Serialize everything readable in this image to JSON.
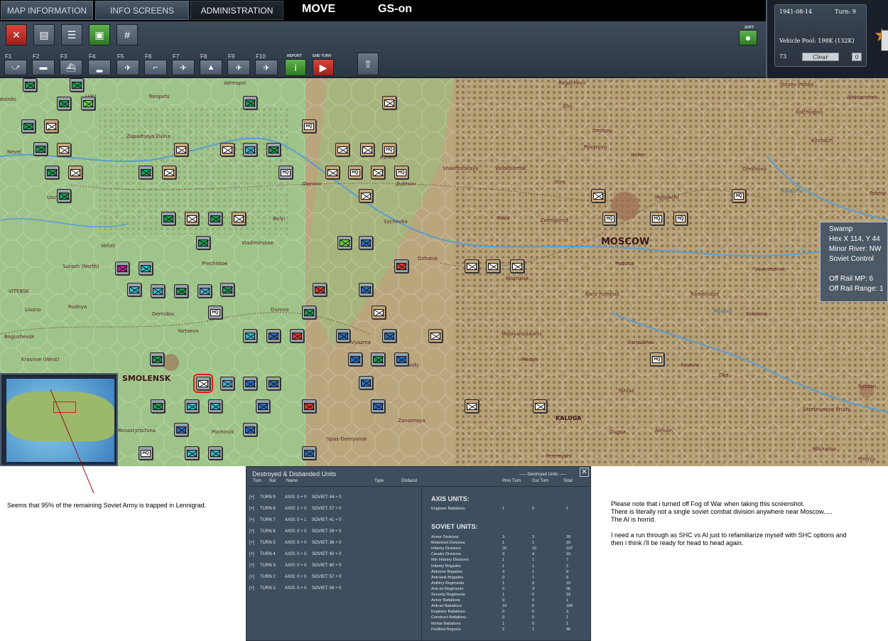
{
  "tabs": [
    "MAP INFORMATION",
    "INFO SCREENS",
    "ADMINISTRATION"
  ],
  "mode": "MOVE",
  "gs": "GS-on",
  "fkeys": [
    "F1",
    "F2",
    "F3",
    "F4",
    "F5",
    "F6",
    "F7",
    "F8",
    "F9",
    "F10"
  ],
  "report_label": "REPORT",
  "endturn_label": "END TURN",
  "soft_label": "SOFT",
  "info": {
    "date": "1941-08-14",
    "turn": "Turn: 9",
    "vehicle_pool": "Vehicle Pool: 198K (132K)",
    "num": "73",
    "clear": "Clear",
    "zero": "0"
  },
  "tooltip": {
    "terrain": "Swamp",
    "hex": "Hex X 114, Y 44",
    "river": "Minor River: NW",
    "control": "Soviet Control",
    "mp": "Off Rail MP: 6",
    "range": "Off Rail Range: 1"
  },
  "map_labels": [
    "LUKI",
    "Toropets",
    "Adreapol",
    "Rogachevo",
    "Klin",
    "Kolniki",
    "Yuryev-Polsky",
    "Kolchugino",
    "Aleksandrov",
    "Kirzhach",
    "Dmitrov",
    "Pokrov",
    "Nevel",
    "Zapadnaya Dvina",
    "Shakhovskaya",
    "Volokolamsk",
    "Istra",
    "Ikshe",
    "Povarovo",
    "Orekhovo",
    "Usvyat",
    "Olenino",
    "Zubtsov",
    "Rzhev",
    "Mytishchi",
    "Sychevka",
    "Ruza",
    "Zvenigorod",
    "Belyi",
    "Velizh",
    "Vladimirskoe",
    "Ozhatsk",
    "Mozhaisk",
    "Podolsk",
    "Voskresensk",
    "Surazh (North)",
    "Prechistoe",
    "VITEBSK",
    "Rudnya",
    "Liozno",
    "Demidov",
    "Durovo",
    "Naro-Fominsk",
    "Ramenskoe",
    "Kolomna",
    "Yartsevo",
    "Bogushevsk",
    "Krasnoe (West)",
    "Vyazma",
    "Maloyaroslavets",
    "Medyn",
    "Serpukhov",
    "Kashira",
    "Vskhody",
    "Zanoznaya",
    "Tarusa",
    "Oka",
    "Ryazan",
    "Serebryanye Prudy",
    "Pochinok",
    "Monastyrschina",
    "Spas-Demyansk",
    "Aleksin",
    "Dugna",
    "Mikhailov",
    "Peremyshl",
    "Pronya",
    "Moskva",
    "Klyazma"
  ],
  "city_labels": {
    "moscow": "MOSCOW",
    "smolensk": "SMOLENSK",
    "kaluga": "KALUGA"
  },
  "dialog": {
    "title": "Destroyed & Disbanded Units",
    "col_turn": "Turn",
    "col_nat": "Nat",
    "col_name": "Name",
    "col_type": "Type",
    "col_disband": "Disband",
    "col_destroyed": "----- Destroyed Units -----",
    "col_prev": "Prev Turn",
    "col_cur": "Cur Turn",
    "col_total": "Total",
    "turns": [
      {
        "t": "TURN 9",
        "axis": "AXIS: 0 + 0",
        "soviet": "SOVIET: 44 + 0"
      },
      {
        "t": "TURN 8",
        "axis": "AXIS: 1 + 0",
        "soviet": "SOVIET: 57 + 0"
      },
      {
        "t": "TURN 7",
        "axis": "AXIS: 0 + 1",
        "soviet": "SOVIET: 41 + 0"
      },
      {
        "t": "TURN 6",
        "axis": "AXIS: 0 + 0",
        "soviet": "SOVIET: 29 + 0"
      },
      {
        "t": "TURN 5",
        "axis": "AXIS: 0 + 0",
        "soviet": "SOVIET: 36 + 0"
      },
      {
        "t": "TURN 4",
        "axis": "AXIS: 0 + 0",
        "soviet": "SOVIET: 40 + 0"
      },
      {
        "t": "TURN 3",
        "axis": "AXIS: 0 + 0",
        "soviet": "SOVIET: 60 + 0"
      },
      {
        "t": "TURN 2",
        "axis": "AXIS: 0 + 0",
        "soviet": "SOVIET: 57 + 0"
      },
      {
        "t": "TURN 1",
        "axis": "AXIS: 0 + 0",
        "soviet": "SOVIET: 58 + 0"
      }
    ],
    "axis_header": "AXIS UNITS:",
    "axis_rows": [
      {
        "name": "Engineer Battalions",
        "prev": "1",
        "cur": "0",
        "total": "1"
      }
    ],
    "soviet_header": "SOVIET UNITS:",
    "soviet_rows": [
      {
        "name": "Armor Divisions",
        "prev": "3",
        "cur": "3",
        "total": "39"
      },
      {
        "name": "Motorized Divisions",
        "prev": "1",
        "cur": "1",
        "total": "20"
      },
      {
        "name": "Infantry Divisions",
        "prev": "26",
        "cur": "22",
        "total": "107"
      },
      {
        "name": "Cavalry Divisions",
        "prev": "3",
        "cur": "4",
        "total": "15"
      },
      {
        "name": "Mtn Infantry Divisions",
        "prev": "1",
        "cur": "1",
        "total": "7"
      },
      {
        "name": "Infantry Brigades",
        "prev": "1",
        "cur": "1",
        "total": "2"
      },
      {
        "name": "Airborne Brigades",
        "prev": "3",
        "cur": "1",
        "total": "9"
      },
      {
        "name": "Anti-tank Brigades",
        "prev": "0",
        "cur": "1",
        "total": "9"
      },
      {
        "name": "Artillery Regiments",
        "prev": "1",
        "cur": "0",
        "total": "10"
      },
      {
        "name": "Anti-air Regiments",
        "prev": "5",
        "cur": "3",
        "total": "26"
      },
      {
        "name": "Security Regiments",
        "prev": "1",
        "cur": "0",
        "total": "18"
      },
      {
        "name": "Armor Battalions",
        "prev": "0",
        "cur": "0",
        "total": "1"
      },
      {
        "name": "Anti-air Battalions",
        "prev": "10",
        "cur": "6",
        "total": "106"
      },
      {
        "name": "Engineer Battalions",
        "prev": "0",
        "cur": "0",
        "total": "3"
      },
      {
        "name": "Construct Battalions",
        "prev": "0",
        "cur": "0",
        "total": "1"
      },
      {
        "name": "Mortar Battalions",
        "prev": "1",
        "cur": "0",
        "total": "1"
      },
      {
        "name": "Fortified Regions",
        "prev": "2",
        "cur": "1",
        "total": "46"
      }
    ]
  },
  "note_left": "Seems that 95% of the remaining Soviet Army is trapped in Lennigrad.",
  "note_right": [
    "Please note that i turned off Fog of War when taking this screenshot.",
    "There is literally not a single soviet combat division anywhere near Moscow.....",
    "The AI is horrid.",
    "",
    "I need a run through as SHC vs AI just to refamiliarize myself with SHC options and",
    "then i think i'll be ready for head to head again."
  ]
}
